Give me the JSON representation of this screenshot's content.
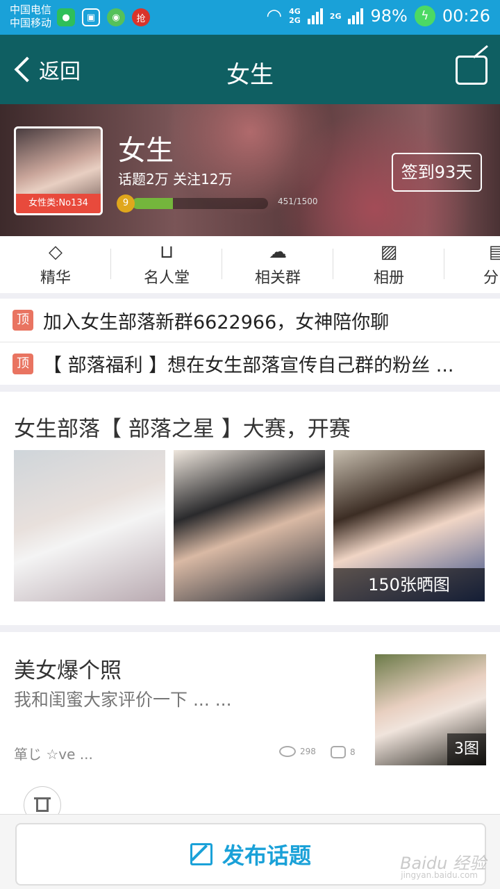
{
  "status_bar": {
    "carrier1": "中国电信",
    "carrier2": "中国移动",
    "net1": "4G",
    "net2": "2G",
    "net3": "2G",
    "battery": "98%",
    "time": "00:26",
    "app_icons": [
      "wechat-icon",
      "gallery-icon",
      "game-icon",
      "red-packet-icon"
    ]
  },
  "title_bar": {
    "back_label": "返回",
    "title": "女生"
  },
  "tribe": {
    "name": "女生",
    "stats": "话题2万 关注12万",
    "avatar_badge": "女性类:No134",
    "level": "9",
    "progress_text": "451/1500",
    "progress_fraction": 0.3,
    "signin_label": "签到93天"
  },
  "tabs": [
    {
      "label": "精华",
      "icon": "diamond-icon"
    },
    {
      "label": "名人堂",
      "icon": "sofa-icon"
    },
    {
      "label": "相关群",
      "icon": "group-icon"
    },
    {
      "label": "相册",
      "icon": "photo-icon"
    },
    {
      "label": "分",
      "icon": "category-icon"
    }
  ],
  "notices": [
    {
      "tag": "顶",
      "text": "加入女生部落新群6622966，女神陪你聊"
    },
    {
      "tag": "顶",
      "text": "【 部落福利 】想在女生部落宣传自己群的粉丝 ..."
    }
  ],
  "contest": {
    "title": "女生部落【 部落之星 】大赛，开赛",
    "photo_count": "150张晒图"
  },
  "post": {
    "title": "美女爆个照",
    "summary": "我和闺蜜大家评价一下 ... ...",
    "author": "箪じ ☆ve ...",
    "views": "298",
    "comments": "8",
    "thumb_count": "3图"
  },
  "bottom": {
    "publish_label": "发布话题",
    "watermark": "Baidu 经验",
    "watermark_sub": "jingyan.baidu.com"
  },
  "colors": {
    "status_bar": "#1aa1d8",
    "title_bar": "#0f5f62",
    "accent": "#1aa1d8",
    "pin_tag": "#e97461",
    "level_fill": "#74b63c"
  }
}
